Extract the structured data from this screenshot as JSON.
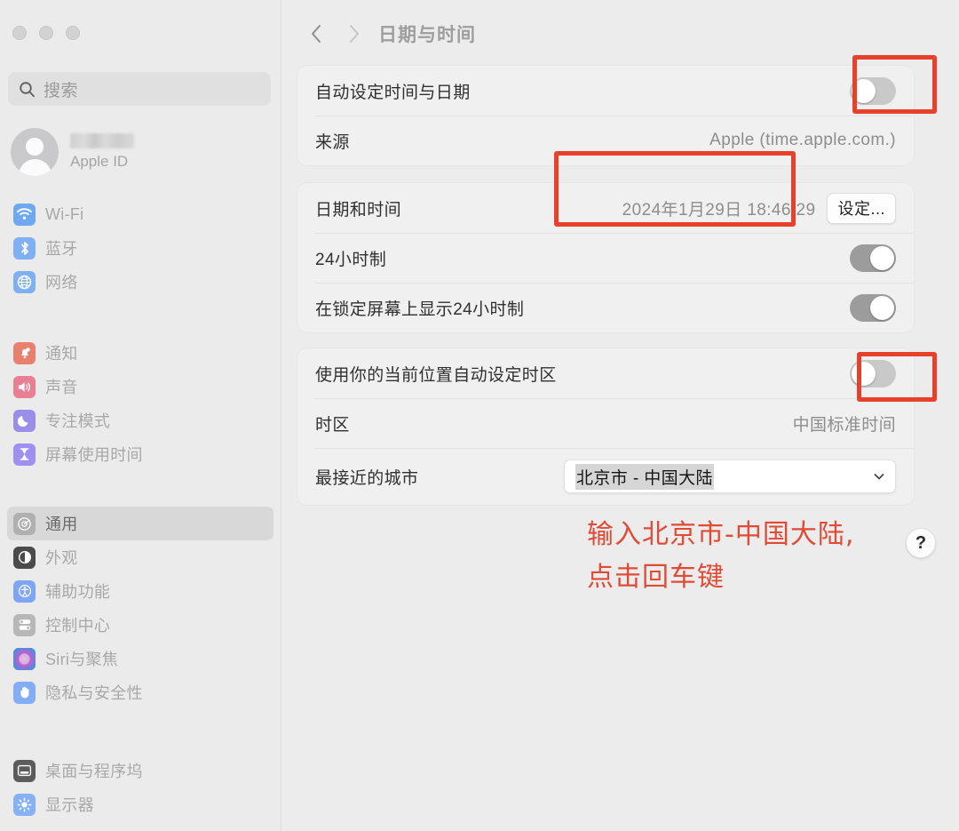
{
  "window": {
    "traffic_lights": [
      "close",
      "minimize",
      "zoom"
    ]
  },
  "sidebar": {
    "search": {
      "placeholder": "搜索",
      "icon": "search-icon"
    },
    "profile": {
      "name_redacted": true,
      "subtitle": "Apple ID"
    },
    "groups": [
      {
        "items": [
          {
            "label": "Wi-Fi",
            "icon": "wifi-icon",
            "color": "#6ea8f0",
            "selected": false
          },
          {
            "label": "蓝牙",
            "icon": "bluetooth-icon",
            "color": "#7fb0f2",
            "selected": false
          },
          {
            "label": "网络",
            "icon": "globe-icon",
            "color": "#7fb0f2",
            "selected": false
          }
        ]
      },
      {
        "items": [
          {
            "label": "通知",
            "icon": "bell-icon",
            "color": "#e8806f",
            "selected": false
          },
          {
            "label": "声音",
            "icon": "speaker-icon",
            "color": "#e87f92",
            "selected": false
          },
          {
            "label": "专注模式",
            "icon": "moon-icon",
            "color": "#9b8ee8",
            "selected": false
          },
          {
            "label": "屏幕使用时间",
            "icon": "hourglass-icon",
            "color": "#9f8ff0",
            "selected": false
          }
        ]
      },
      {
        "items": [
          {
            "label": "通用",
            "icon": "gear-icon",
            "color": "#b0b0b0",
            "selected": true
          },
          {
            "label": "外观",
            "icon": "appearance-icon",
            "color": "#4b4b4b",
            "selected": false
          },
          {
            "label": "辅助功能",
            "icon": "accessibility-icon",
            "color": "#7ea6f5",
            "selected": false
          },
          {
            "label": "控制中心",
            "icon": "control-center-icon",
            "color": "#b7b7b7",
            "selected": false
          },
          {
            "label": "Siri与聚焦",
            "icon": "siri-icon",
            "color": "#7e6fa8",
            "selected": false
          },
          {
            "label": "隐私与安全性",
            "icon": "hand-icon",
            "color": "#83adf4",
            "selected": false
          }
        ]
      },
      {
        "items": [
          {
            "label": "桌面与程序坞",
            "icon": "desktop-dock-icon",
            "color": "#5c5c5c",
            "selected": false
          },
          {
            "label": "显示器",
            "icon": "brightness-icon",
            "color": "#86b2f5",
            "selected": false
          }
        ]
      }
    ]
  },
  "header": {
    "back_icon": "chevron-left-icon",
    "forward_icon": "chevron-right-icon",
    "title": "日期与时间"
  },
  "cards": {
    "auto_time": {
      "rows": [
        {
          "label": "自动设定时间与日期",
          "control": "toggle",
          "state": "off",
          "highlighted": true
        },
        {
          "label": "来源",
          "value": "Apple (time.apple.com.)"
        }
      ]
    },
    "date_time": {
      "rows": [
        {
          "label": "日期和时间",
          "value": "2024年1月29日 18:46:29",
          "button": "设定..."
        },
        {
          "label": "24小时制",
          "control": "toggle",
          "state": "on"
        },
        {
          "label": "在锁定屏幕上显示24小时制",
          "control": "toggle",
          "state": "on"
        }
      ]
    },
    "timezone": {
      "rows": [
        {
          "label": "使用你的当前位置自动设定时区",
          "control": "toggle",
          "state": "off",
          "highlighted": true
        },
        {
          "label": "时区",
          "value": "中国标准时间"
        },
        {
          "label": "最接近的城市",
          "combo_value": "北京市 - 中国大陆",
          "highlighted": true
        }
      ]
    }
  },
  "annotation": {
    "line1": "输入北京市-中国大陆,",
    "line2": "点击回车键",
    "color": "#e04b36"
  },
  "help_button": {
    "label": "?"
  }
}
